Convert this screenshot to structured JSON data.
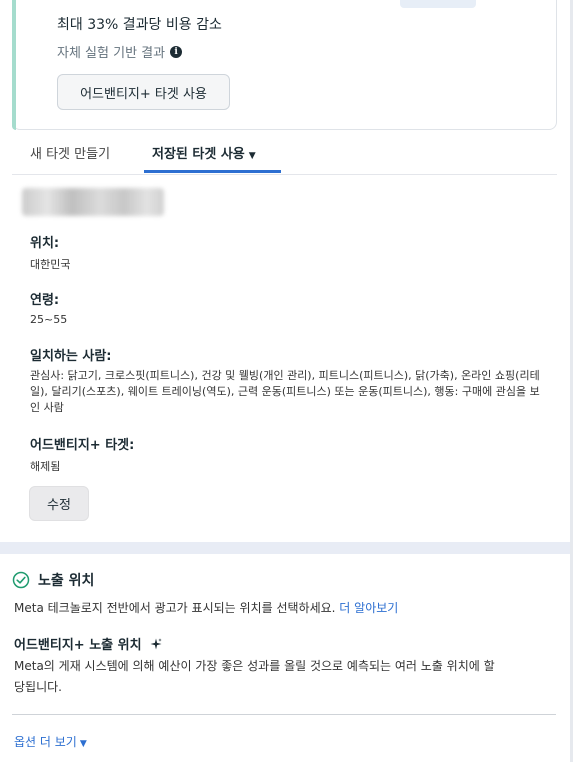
{
  "advantage_card": {
    "headline": "최대 33% 결과당 비용 감소",
    "subtext": "자체 실험 기반 결과",
    "info_icon": "info-icon",
    "button_label": "어드밴티지+ 타겟 사용",
    "accent_color": "#a5dccd"
  },
  "tabs": [
    {
      "label": "새 타겟 만들기",
      "active": false
    },
    {
      "label": "저장된 타겟 사용",
      "active": true
    }
  ],
  "audience": {
    "location_label": "위치:",
    "location_value": "대한민국",
    "age_label": "연령:",
    "age_value": "25~55",
    "match_label": "일치하는 사람:",
    "match_value": "관심사: 닭고기, 크로스핏(피트니스), 건강 및 웰빙(개인 관리), 피트니스(피트니스), 닭(가축), 온라인 쇼핑(리테일), 달리기(스포츠), 웨이트 트레이닝(역도), 근력 운동(피트니스) 또는 운동(피트니스), 행동: 구매에 관심을 보인 사람",
    "advantage_label": "어드밴티지+ 타겟:",
    "advantage_value": "해제됨",
    "edit_label": "수정"
  },
  "placements": {
    "title": "노출 위치",
    "description": "Meta 테크놀로지 전반에서 광고가 표시되는 위치를 선택하세요.",
    "learn_more": "더 알아보기",
    "advantage_title": "어드밴티지+ 노출 위치",
    "advantage_description": "Meta의 게재 시스템에 의해 예산이 가장 좋은 성과를 올릴 것으로 예측되는 여러 노출 위치에 할당됩니다.",
    "more_options": "옵션 더 보기"
  },
  "colors": {
    "link": "#2d6fd1",
    "tab_active": "#2d6fd1",
    "check": "#1f9b6f"
  }
}
